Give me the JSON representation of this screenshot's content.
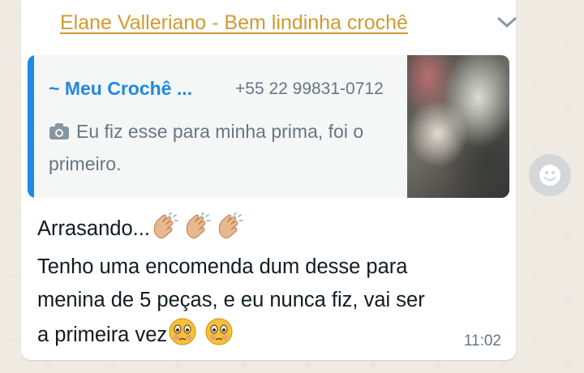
{
  "message": {
    "sender_name": "Elane Valleriano - Bem lindinha crochê",
    "quoted": {
      "author": "~ Meu Crochê ...",
      "phone": "+55 22 99831-0712",
      "text": "Eu fiz esse para minha prima, foi o primeiro.",
      "attachment_icon": "camera-icon"
    },
    "lines": [
      "Arrasando...",
      "Tenho uma encomenda dum desse para",
      "menina de 5 peças,  e eu nunca fiz, vai ser",
      "a primeira vez"
    ],
    "emojis": {
      "clapping": "clapping-hands-light-skin",
      "flushed": "face-holding-back-tears"
    },
    "time": "11:02"
  },
  "icons": {
    "menu": "chevron-down-icon",
    "react": "emoji-smile-icon"
  },
  "colors": {
    "sender": "#d19a30",
    "quote_accent": "#1e88e5",
    "background": "#efeae2",
    "bubble": "#ffffff"
  }
}
